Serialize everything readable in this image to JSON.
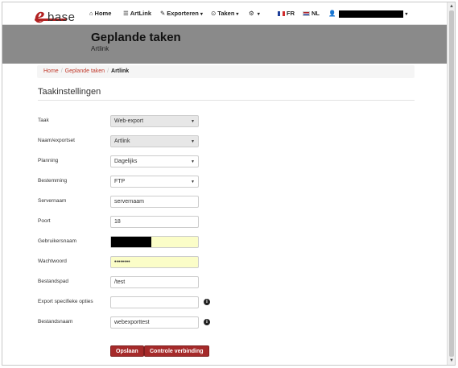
{
  "logo": {
    "letter": "e",
    "text": "base"
  },
  "nav": {
    "home": {
      "icon": "⌂",
      "label": "Home"
    },
    "artlink": {
      "icon": "☰",
      "label": "ArtLink"
    },
    "exporteren": {
      "icon": "✎",
      "label": "Exporteren"
    },
    "taken": {
      "icon": "⊙",
      "label": "Taken"
    },
    "settings_icon": "⚙",
    "lang_fr": "FR",
    "lang_nl": "NL",
    "user_icon": "👤",
    "caret": "▾"
  },
  "header": {
    "title": "Geplande taken",
    "subtitle": "Artlink"
  },
  "breadcrumb": {
    "home": "Home",
    "geplande": "Geplande taken",
    "current": "Artlink",
    "separator": "/"
  },
  "section": {
    "title": "Taakinstellingen"
  },
  "form": {
    "taak": {
      "label": "Taak",
      "value": "Web-export"
    },
    "naam": {
      "label": "Naam/exportset",
      "value": "Artlink"
    },
    "planning": {
      "label": "Planning",
      "value": "Dagelijks"
    },
    "bestemming": {
      "label": "Bestemming",
      "value": "FTP"
    },
    "servernaam": {
      "label": "Servernaam",
      "value": "servernaam"
    },
    "poort": {
      "label": "Poort",
      "value": "18"
    },
    "gebruikersnaam": {
      "label": "Gebruikersnaam",
      "value": ""
    },
    "wachtwoord": {
      "label": "Wachtwoord",
      "value": "••••••••"
    },
    "bestandspad": {
      "label": "Bestandspad",
      "value": "/test"
    },
    "export_opties": {
      "label": "Export specifieke opties",
      "value": ""
    },
    "bestandsnaam": {
      "label": "Bestandsnaam",
      "value": "webexporttest"
    },
    "info_icon": "i",
    "select_caret": "▼"
  },
  "buttons": {
    "save": "Opslaan",
    "check": "Controle verbinding"
  },
  "scroll": {
    "up": "▲",
    "down": "▼"
  }
}
